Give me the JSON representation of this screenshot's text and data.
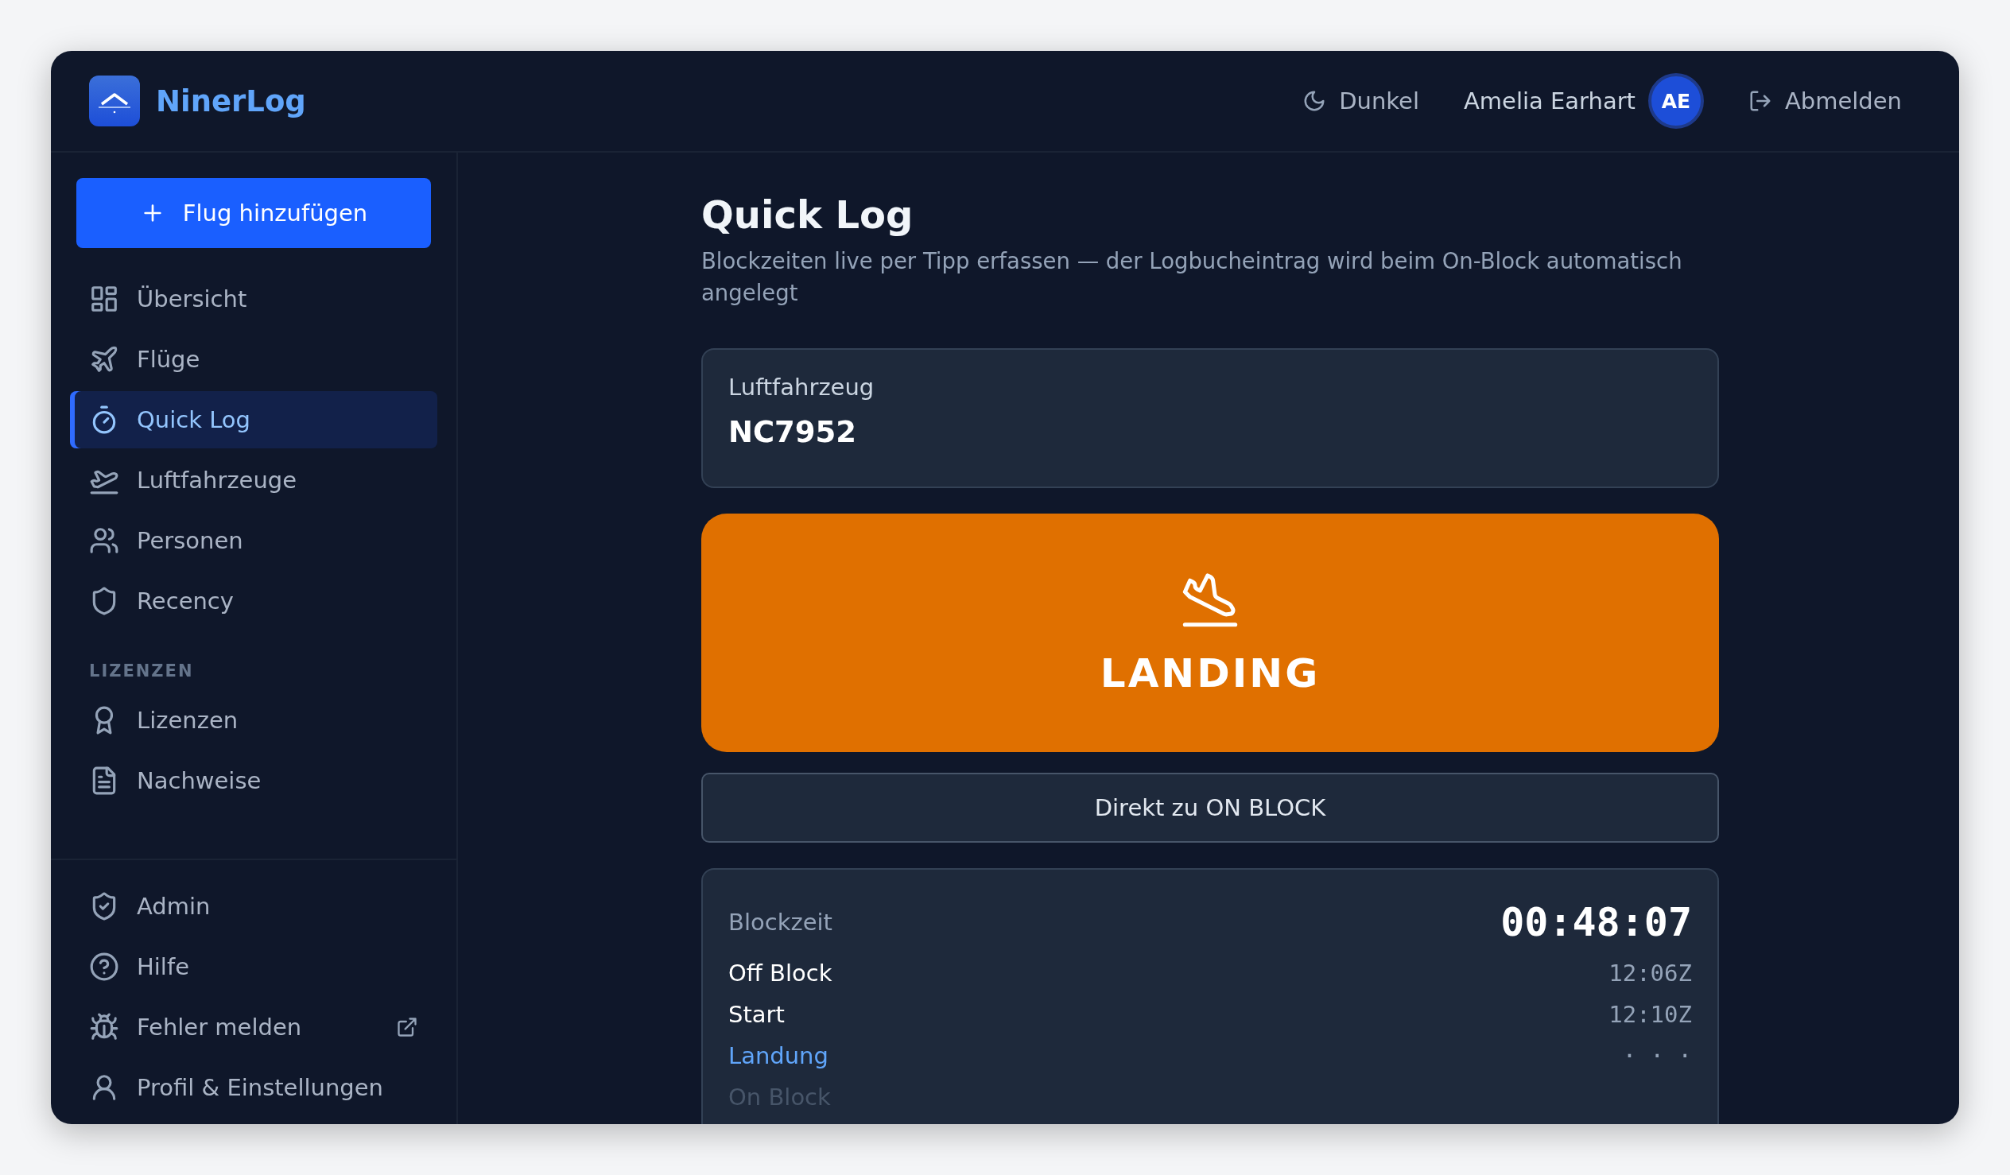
{
  "app": {
    "name": "NinerLog"
  },
  "header": {
    "theme_toggle": "Dunkel",
    "user_name": "Amelia Earhart",
    "avatar_initials": "AE",
    "logout": "Abmelden"
  },
  "sidebar": {
    "add_button": "Flug hinzufügen",
    "items": [
      {
        "label": "Übersicht",
        "selected": false
      },
      {
        "label": "Flüge",
        "selected": false
      },
      {
        "label": "Quick Log",
        "selected": true
      },
      {
        "label": "Luftfahrzeuge",
        "selected": false
      },
      {
        "label": "Personen",
        "selected": false
      },
      {
        "label": "Recency",
        "selected": false
      }
    ],
    "sections": [
      {
        "heading": "LIZENZEN",
        "items": [
          {
            "label": "Lizenzen",
            "selected": false
          },
          {
            "label": "Nachweise",
            "selected": false
          }
        ]
      }
    ],
    "footer_items": [
      {
        "label": "Admin",
        "external": false
      },
      {
        "label": "Hilfe",
        "external": false
      },
      {
        "label": "Fehler melden",
        "external": true
      },
      {
        "label": "Profil & Einstellungen",
        "external": false
      }
    ]
  },
  "main": {
    "title": "Quick Log",
    "subtitle": "Blockzeiten live per Tipp erfassen — der Logbucheintrag wird beim On-Block automatisch angelegt",
    "aircraft": {
      "label": "Luftfahrzeug",
      "value": "NC7952"
    },
    "action": {
      "kind": "landing",
      "label": "LANDING"
    },
    "secondary_button": "Direkt zu ON BLOCK",
    "blocktime": {
      "label": "Blockzeit",
      "value": "00:48:07",
      "rows": [
        {
          "label": "Off Block",
          "time": "12:06Z",
          "completed": true,
          "active": false
        },
        {
          "label": "Start",
          "time": "12:10Z",
          "completed": true,
          "active": false
        },
        {
          "label": "Landung",
          "time": "· · ·",
          "completed": false,
          "active": true
        },
        {
          "label": "On Block",
          "completed": false,
          "active": false
        }
      ]
    }
  }
}
